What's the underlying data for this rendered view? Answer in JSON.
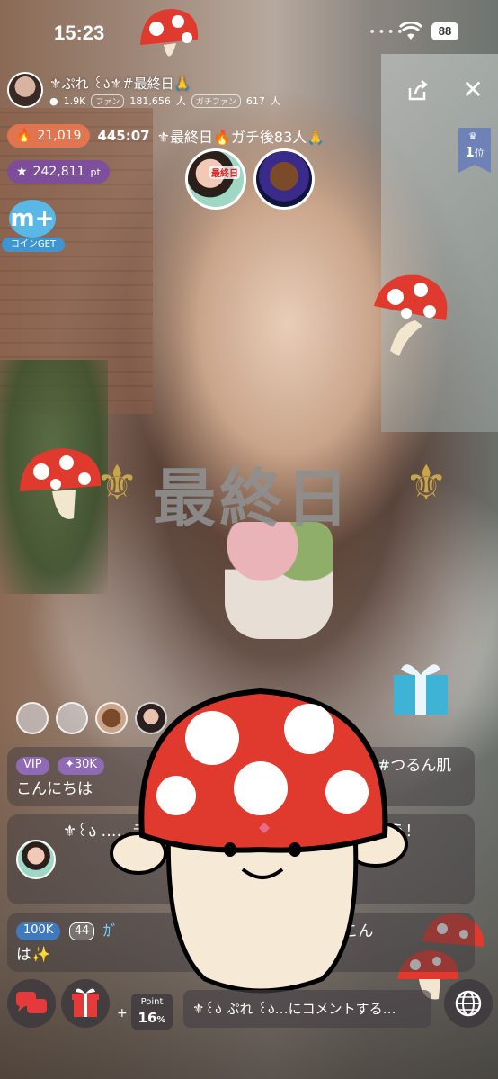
{
  "status": {
    "time": "15:23",
    "battery": "88"
  },
  "header": {
    "streamer_name": "⚜ぷれ ꒰ა⚜#最終日🙏",
    "viewers_count": "1.9K",
    "fan_label": "ファン",
    "fan_count": "181,656",
    "fan_unit": "人",
    "gachi_label": "ガチファン",
    "gachi_count": "617",
    "gachi_unit": "人",
    "flame_score": "21,019",
    "timer": "445:07",
    "title": "⚜最終日🔥ガチ後83人🙏",
    "points": "242,811",
    "points_unit": "pt",
    "rank_num": "1",
    "rank_unit": "位",
    "guest_label": "最終日"
  },
  "coin_get": {
    "icon": "m+",
    "label": "コインGET"
  },
  "center_title": "最終日",
  "chat": [
    {
      "badges": [
        "VIP",
        "✦30K"
      ],
      "tail": "#つるん肌",
      "text": "こんにちは"
    },
    {
      "text": "⚜꒰ა ……ラブに加入して、ファン……を楽しもう！"
    },
    {
      "badges": [
        "100K",
        "44"
      ],
      "name": "ｶﾞ",
      "tail": "のたくや こん",
      "text": "は✨"
    }
  ],
  "bottom": {
    "plus": "+",
    "point_label": "Point",
    "point_value": "16",
    "point_unit": "%",
    "comment_placeholder": "⚜꒰ა ぷれ ꒰ა…にコメントする…"
  },
  "colors": {
    "accent_orange": "#f07850",
    "accent_purple": "#7846b4",
    "rank_blue": "#6e82b8",
    "mushroom_red": "#e03a2e"
  }
}
